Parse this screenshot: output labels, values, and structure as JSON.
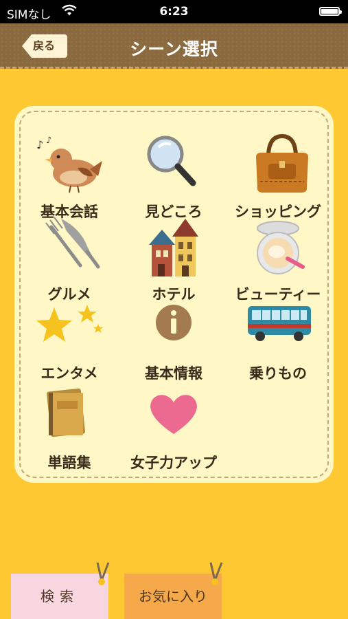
{
  "status_bar": {
    "carrier": "SIMなし",
    "time": "6:23"
  },
  "nav": {
    "back_label": "戻る",
    "title": "シーン選択"
  },
  "scenes": [
    {
      "label": "基本会話",
      "icon": "bird-icon"
    },
    {
      "label": "見どころ",
      "icon": "magnifier-icon"
    },
    {
      "label": "ショッピング",
      "icon": "handbag-icon"
    },
    {
      "label": "グルメ",
      "icon": "fork-knife-icon"
    },
    {
      "label": "ホテル",
      "icon": "hotel-buildings-icon"
    },
    {
      "label": "ビューティー",
      "icon": "compact-powder-icon"
    },
    {
      "label": "エンタメ",
      "icon": "stars-icon"
    },
    {
      "label": "基本情報",
      "icon": "info-icon"
    },
    {
      "label": "乗りもの",
      "icon": "bus-icon"
    },
    {
      "label": "単語集",
      "icon": "book-icon"
    },
    {
      "label": "女子力アップ",
      "icon": "heart-icon"
    }
  ],
  "tabs": {
    "search_label": "検索",
    "favorites_label": "お気に入り"
  },
  "colors": {
    "background": "#FDC832",
    "navbar": "#8A6A3E",
    "panel": "#FFF7C6",
    "search_tab": "#F7D6E0",
    "favorites_tab": "#F6A94A"
  }
}
